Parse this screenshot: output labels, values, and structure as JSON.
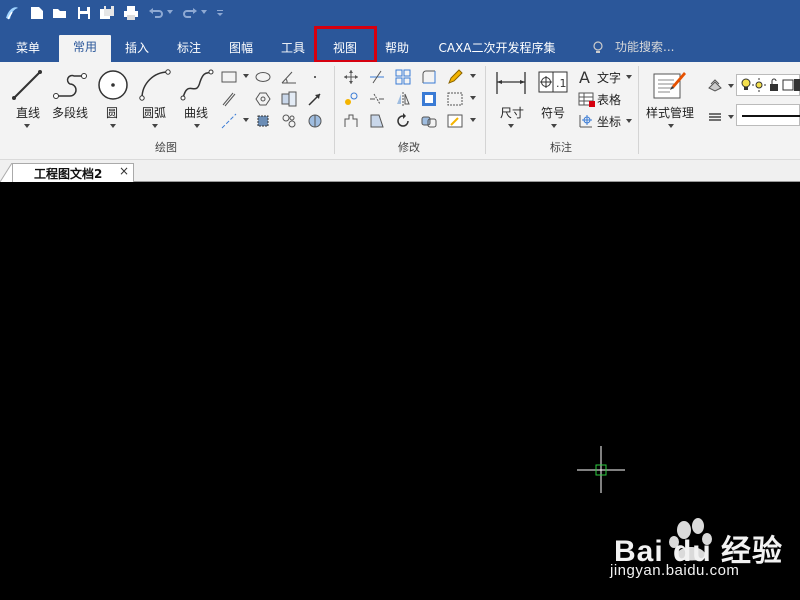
{
  "tabs": {
    "menu": "菜单",
    "home": "常用",
    "insert": "插入",
    "annotate": "标注",
    "frame": "图幅",
    "tools": "工具",
    "view": "视图",
    "help": "帮助",
    "dev": "CAXA二次开发程序集",
    "search": "功能搜索..."
  },
  "ribbon": {
    "draw": {
      "line": "直线",
      "polyline": "多段线",
      "circle": "圆",
      "arc": "圆弧",
      "curve": "曲线",
      "group_label": "绘图"
    },
    "modify": {
      "group_label": "修改"
    },
    "annotate": {
      "dimension": "尺寸",
      "symbol": "符号",
      "text": "文字",
      "table": "表格",
      "coordinate": "坐标",
      "group_label": "标注"
    },
    "style": {
      "manage": "样式管理"
    }
  },
  "document": {
    "tab_title": "工程图文档2",
    "close": "×"
  },
  "watermark": {
    "brand": "Bai du 经验",
    "url": "jingyan.baidu.com"
  },
  "colors": {
    "accent": "#2b579a",
    "highlight": "#d6000f",
    "canvas": "#000000"
  }
}
